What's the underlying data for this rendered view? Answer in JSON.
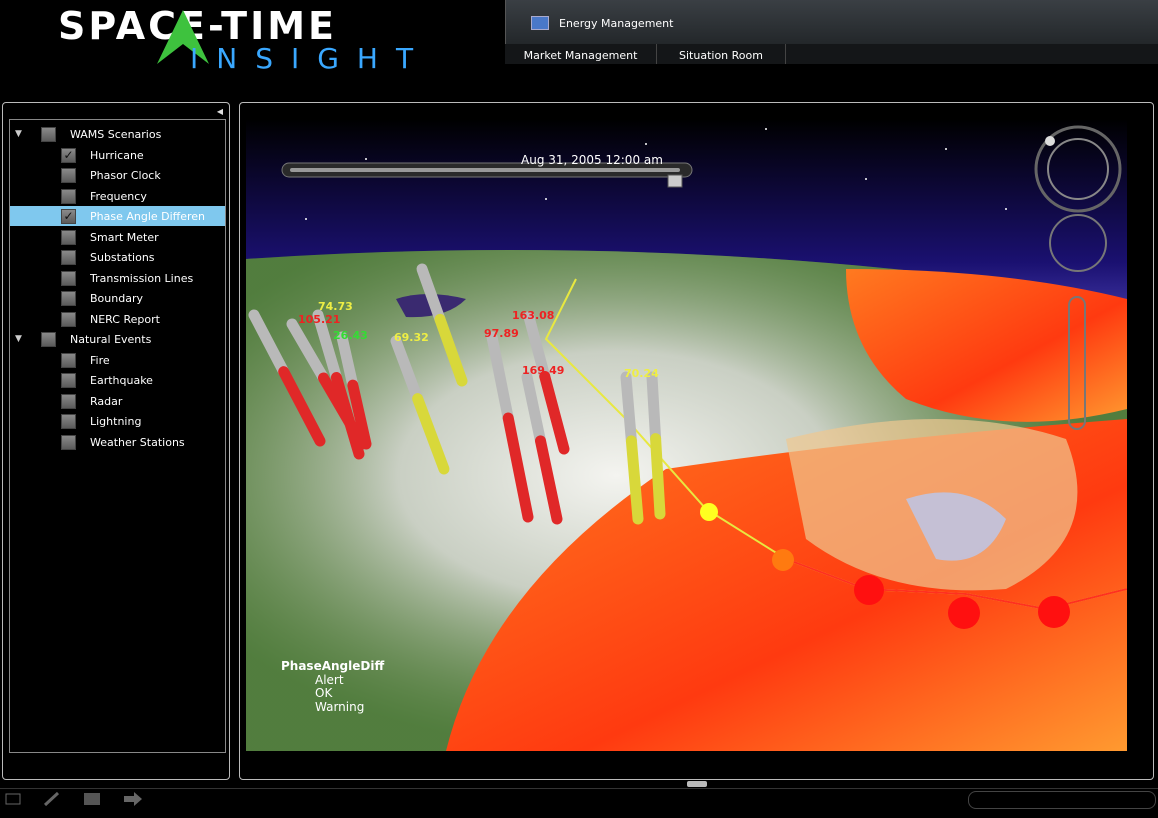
{
  "logo": {
    "line1": "SPACE-TIME",
    "line2": "INSIGHT"
  },
  "header": {
    "app_title": "Energy Management",
    "tabs": [
      "Market Management",
      "Situation Room"
    ]
  },
  "tree": {
    "groups": [
      {
        "label": "WAMS Scenarios",
        "items": [
          {
            "label": "Hurricane",
            "checked": true
          },
          {
            "label": "Phasor Clock",
            "checked": false
          },
          {
            "label": "Frequency",
            "checked": false
          },
          {
            "label": "Phase Angle Differen",
            "checked": true,
            "selected": true
          },
          {
            "label": "Smart Meter",
            "checked": false
          },
          {
            "label": "Substations",
            "checked": false
          },
          {
            "label": "Transmission Lines",
            "checked": false
          },
          {
            "label": "Boundary",
            "checked": false
          },
          {
            "label": "NERC Report",
            "checked": false
          }
        ]
      },
      {
        "label": "Natural Events",
        "items": [
          {
            "label": "Fire",
            "checked": false
          },
          {
            "label": "Earthquake",
            "checked": false
          },
          {
            "label": "Radar",
            "checked": false
          },
          {
            "label": "Lightning",
            "checked": false
          },
          {
            "label": "Weather Stations",
            "checked": false
          }
        ]
      }
    ]
  },
  "map": {
    "timeline_date": "Aug 31, 2005  12:00 am",
    "legend": {
      "title": "PhaseAngleDiff",
      "items": [
        "Alert",
        "OK",
        "Warning"
      ]
    },
    "values": [
      {
        "text": "74.73",
        "status": "Warning"
      },
      {
        "text": "105.21",
        "status": "Alert"
      },
      {
        "text": "26.43",
        "status": "OK"
      },
      {
        "text": "69.32",
        "status": "Warning"
      },
      {
        "text": "97.89",
        "status": "Alert"
      },
      {
        "text": "163.08",
        "status": "Alert"
      },
      {
        "text": "169.49",
        "status": "Alert"
      },
      {
        "text": "70.24",
        "status": "Warning"
      }
    ]
  },
  "colors": {
    "alert": "#e02020",
    "ok": "#33cc33",
    "warning": "#e6e040",
    "selection": "#7fc8ee",
    "logo_blue": "#3aa8ff",
    "logo_green": "#3ec23e"
  },
  "icons": [
    "tree-expand-icon",
    "checkbox-icon",
    "check-icon",
    "compass-icon",
    "zoom-icon",
    "pencil-icon",
    "forward-arrow-icon"
  ]
}
